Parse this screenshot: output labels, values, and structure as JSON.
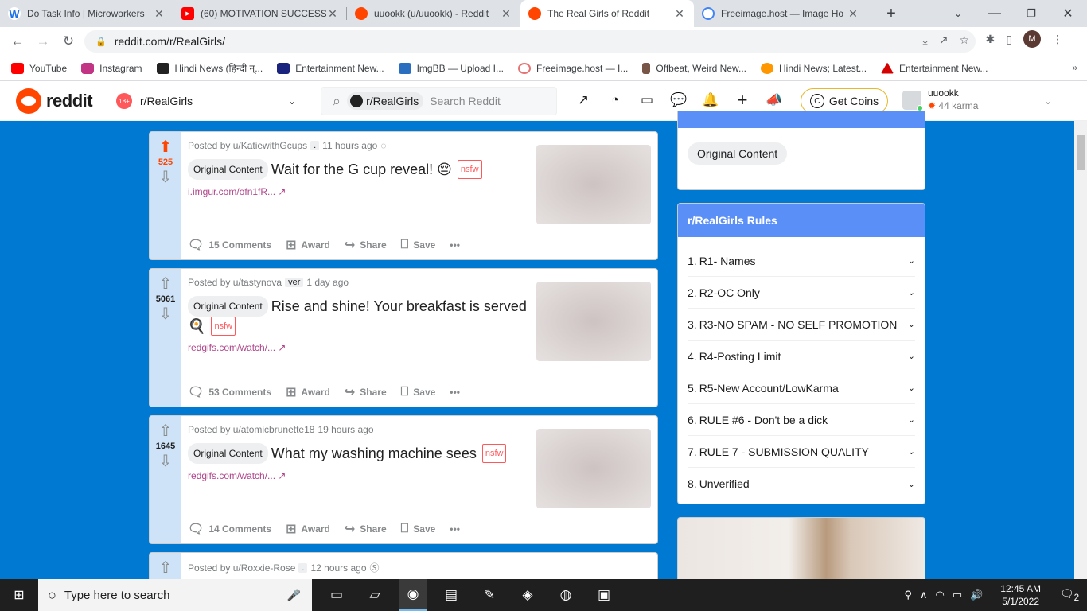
{
  "browser": {
    "tabs": [
      {
        "title": "Do Task Info | Microworkers",
        "icon": "microworkers-icon",
        "color": "#1a73e8",
        "glyph": "W"
      },
      {
        "title": "(60) MOTIVATION SUCCESS",
        "icon": "youtube-icon",
        "color": "#ff0000",
        "glyph": "▶"
      },
      {
        "title": "uuookk (u/uuookk) - Reddit",
        "icon": "reddit-icon",
        "color": "#ff4500",
        "glyph": "●"
      },
      {
        "title": "The Real Girls of Reddit",
        "icon": "reddit-icon",
        "color": "#ff4500",
        "glyph": "●"
      },
      {
        "title": "Freeimage.host — Image Ho",
        "icon": "freeimage-icon",
        "color": "#4285f4",
        "glyph": "◐"
      }
    ],
    "url": "reddit.com/r/RealGirls/",
    "profile_initial": "M",
    "bookmarks": [
      {
        "label": "YouTube",
        "color": "#ff0000"
      },
      {
        "label": "Instagram",
        "color": "#c13584"
      },
      {
        "label": "Hindi News (हिन्दी न्...",
        "color": "#222222"
      },
      {
        "label": "Entertainment New...",
        "color": "#1a237e"
      },
      {
        "label": "ImgBB — Upload I...",
        "color": "#2a6ebf"
      },
      {
        "label": "Freeimage.host — I...",
        "color": "#e57373"
      },
      {
        "label": "Offbeat, Weird New...",
        "color": "#795548"
      },
      {
        "label": "Hindi News; Latest...",
        "color": "#ff9800"
      },
      {
        "label": "Entertainment New...",
        "color": "#d50000"
      }
    ]
  },
  "header": {
    "wordmark": "reddit",
    "community": "r/RealGirls",
    "nsfw_badge": "18+",
    "search_chip": "r/RealGirls",
    "search_placeholder": "Search Reddit",
    "coins_label": "Get Coins",
    "username": "uuookk",
    "karma": "44 karma"
  },
  "posts": [
    {
      "author": "Posted by u/KatiewithGcups",
      "user_flair": ".",
      "time": "11 hours ago",
      "score": "525",
      "upvoted": true,
      "flair": "Original Content",
      "title": "Wait for the G cup reveal! 😔",
      "nsfw": "nsfw",
      "link": "i.imgur.com/ofn1fR...",
      "comments": "15 Comments",
      "award": "Award",
      "share": "Share",
      "save": "Save"
    },
    {
      "author": "Posted by u/tastynova",
      "user_flair": "ver",
      "time": "1 day ago",
      "score": "5061",
      "upvoted": false,
      "flair": "Original Content",
      "title": "Rise and shine! Your breakfast is served 🍳",
      "nsfw": "nsfw",
      "link": "redgifs.com/watch/...",
      "comments": "53 Comments",
      "award": "Award",
      "share": "Share",
      "save": "Save"
    },
    {
      "author": "Posted by u/atomicbrunette18",
      "user_flair": "",
      "time": "19 hours ago",
      "score": "1645",
      "upvoted": false,
      "flair": "Original Content",
      "title": "What my washing machine sees",
      "nsfw": "nsfw",
      "link": "redgifs.com/watch/...",
      "comments": "14 Comments",
      "award": "Award",
      "share": "Share",
      "save": "Save"
    },
    {
      "author": "Posted by u/Roxxie-Rose",
      "user_flair": ".",
      "time": "12 hours ago"
    }
  ],
  "sidebar": {
    "flair_chip": "Original Content",
    "rules_title": "r/RealGirls Rules",
    "rules": [
      {
        "num": "1.",
        "text": "R1- Names"
      },
      {
        "num": "2.",
        "text": "R2-OC Only"
      },
      {
        "num": "3.",
        "text": "R3-NO SPAM - NO SELF PROMOTION"
      },
      {
        "num": "4.",
        "text": "R4-Posting Limit"
      },
      {
        "num": "5.",
        "text": "R5-New Account/LowKarma"
      },
      {
        "num": "6.",
        "text": "RULE #6 - Don't be a dick"
      },
      {
        "num": "7.",
        "text": "RULE 7 - SUBMISSION QUALITY"
      },
      {
        "num": "8.",
        "text": "Unverified"
      }
    ]
  },
  "taskbar": {
    "search_placeholder": "Type here to search",
    "time": "12:45 AM",
    "date": "5/1/2022",
    "notifications": "2"
  }
}
